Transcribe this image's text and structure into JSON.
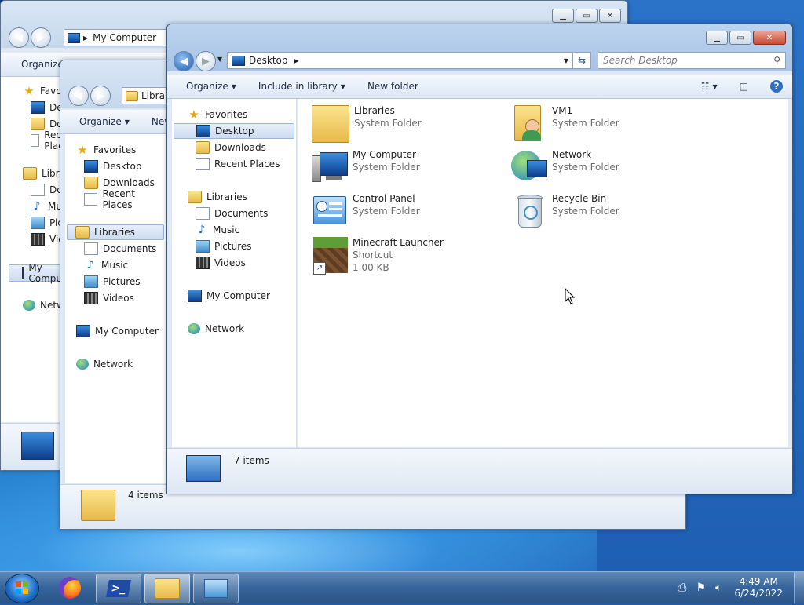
{
  "back_window": {
    "address": "My Computer",
    "toolbar_organize": "Organize",
    "nav": {
      "favorites": "Favorites",
      "desktop": "Desktop",
      "downloads": "Downloads",
      "recent": "Recent Places",
      "libraries": "Libraries",
      "documents": "Documents",
      "music": "Music",
      "pictures": "Pictures",
      "videos": "Videos",
      "computer": "My Computer",
      "network": "Network"
    }
  },
  "middle_window": {
    "address": "Libraries",
    "toolbar": {
      "organize": "Organize",
      "new": "New"
    },
    "nav": {
      "favorites": "Favorites",
      "desktop": "Desktop",
      "downloads": "Downloads",
      "recent": "Recent Places",
      "libraries": "Libraries",
      "documents": "Documents",
      "music": "Music",
      "pictures": "Pictures",
      "videos": "Videos",
      "computer": "My Computer",
      "network": "Network"
    },
    "status": "4 items"
  },
  "front_window": {
    "address": "Desktop",
    "search_placeholder": "Search Desktop",
    "toolbar": {
      "organize": "Organize",
      "include": "Include in library",
      "new_folder": "New folder"
    },
    "nav": {
      "favorites": "Favorites",
      "desktop": "Desktop",
      "downloads": "Downloads",
      "recent": "Recent Places",
      "libraries": "Libraries",
      "documents": "Documents",
      "music": "Music",
      "pictures": "Pictures",
      "videos": "Videos",
      "computer": "My Computer",
      "network": "Network"
    },
    "items": [
      {
        "name": "Libraries",
        "type": "System Folder",
        "icon": "libraries-icon"
      },
      {
        "name": "VM1",
        "type": "System Folder",
        "icon": "user-folder-icon"
      },
      {
        "name": "My Computer",
        "type": "System Folder",
        "icon": "computer-icon"
      },
      {
        "name": "Network",
        "type": "System Folder",
        "icon": "network-icon"
      },
      {
        "name": "Control Panel",
        "type": "System Folder",
        "icon": "control-panel-icon"
      },
      {
        "name": "Recycle Bin",
        "type": "System Folder",
        "icon": "recycle-bin-icon"
      },
      {
        "name": "Minecraft Launcher",
        "type": "Shortcut",
        "size": "1.00 KB",
        "icon": "minecraft-icon"
      }
    ],
    "status": "7 items"
  },
  "taskbar": {
    "time": "4:49 AM",
    "date": "6/24/2022"
  }
}
